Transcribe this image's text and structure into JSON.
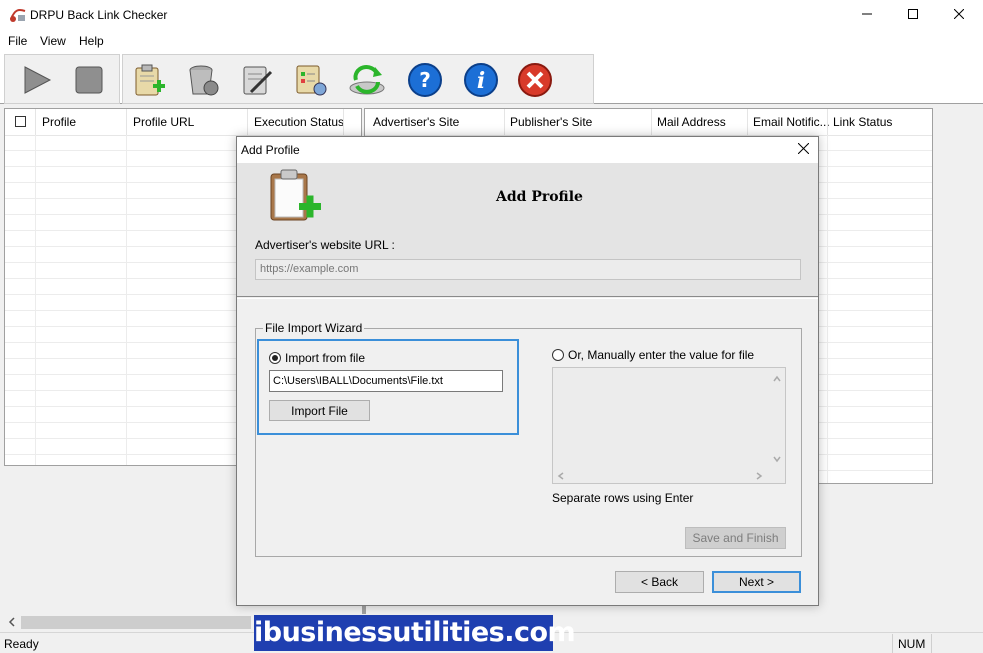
{
  "window": {
    "title": "DRPU Back Link Checker",
    "controls": [
      "minimize-icon",
      "maximize-icon",
      "close-icon"
    ]
  },
  "menu": {
    "items": [
      "File",
      "View",
      "Help"
    ]
  },
  "toolbar": {
    "group1": [
      "play-icon",
      "stop-icon"
    ],
    "group2": [
      "add-profile-icon",
      "delete-profile-icon",
      "edit-profile-icon",
      "settings-profile-icon",
      "refresh-icon",
      "help-icon",
      "info-icon",
      "exit-icon"
    ]
  },
  "left_grid": {
    "columns": [
      "Profile",
      "Profile URL",
      "Execution Status"
    ]
  },
  "right_grid": {
    "columns": [
      "Advertiser's Site",
      "Publisher's Site",
      "Mail Address",
      "Email Notific...",
      "Link Status"
    ]
  },
  "status": {
    "text": "Ready",
    "num": "NUM"
  },
  "watermark": "ibusinessutilities.com",
  "dialog": {
    "title": "Add Profile",
    "heading": "Add Profile",
    "url_label": "Advertiser's website URL :",
    "url_placeholder": "https://example.com",
    "wizard_legend": "File Import Wizard",
    "import_from_file_label": "Import from file",
    "file_path": "C:\\Users\\IBALL\\Documents\\File.txt",
    "import_button": "Import File",
    "manual_label": "Or, Manually enter the value for file",
    "separate_rows_label": "Separate rows using Enter",
    "save_finish_button": "Save and Finish",
    "back_button": "< Back",
    "next_button": "Next >",
    "selected_option": "import_from_file"
  },
  "colors": {
    "accent_blue": "#3b8fd9",
    "watermark_bg": "#1f3fb0",
    "green_plus": "#2bb52b",
    "help_blue": "#1c6fd6",
    "exit_red": "#d83a2a"
  }
}
